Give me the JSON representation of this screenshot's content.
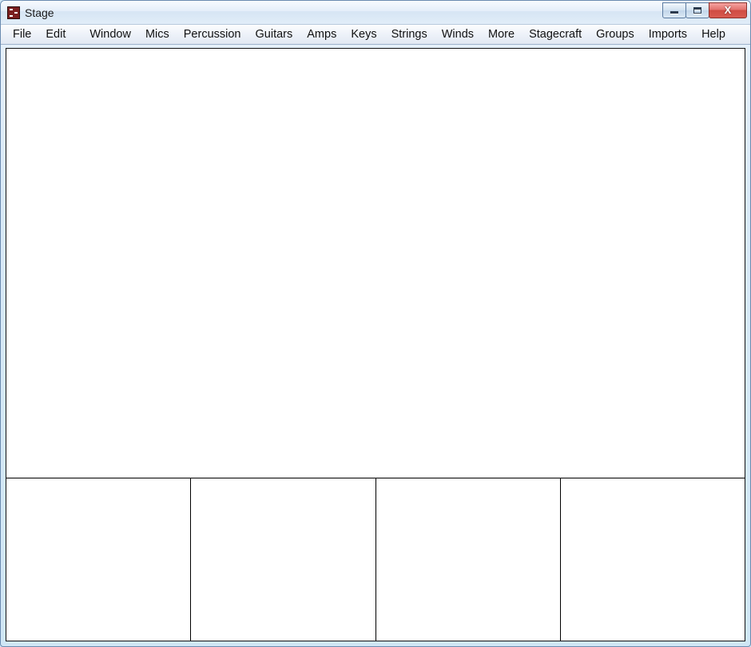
{
  "window": {
    "title": "Stage"
  },
  "menu": {
    "items": [
      "File",
      "Edit",
      "Window",
      "Mics",
      "Percussion",
      "Guitars",
      "Amps",
      "Keys",
      "Strings",
      "Winds",
      "More",
      "Stagecraft",
      "Groups",
      "Imports",
      "Help"
    ]
  },
  "controls": {
    "close_glyph": "X"
  }
}
